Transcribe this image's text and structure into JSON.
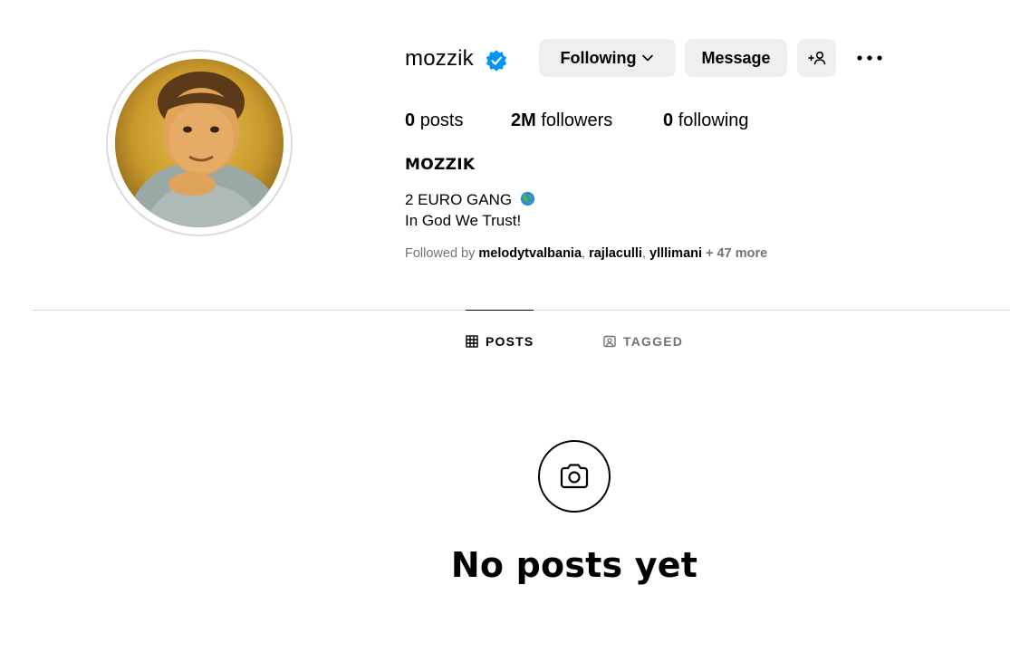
{
  "profile": {
    "username": "mozzik",
    "verified": true,
    "full_name": "MOZZIK",
    "bio_line_1": "2 EURO GANG",
    "bio_line_1_emoji": "globe-icon",
    "bio_line_2": "In God We Trust!"
  },
  "actions": {
    "following_label": "Following",
    "message_label": "Message"
  },
  "stats": {
    "posts_count": "0",
    "posts_label": "posts",
    "followers_count": "2M",
    "followers_label": "followers",
    "following_count": "0",
    "following_label": "following"
  },
  "followed_by": {
    "prefix": "Followed by",
    "names": [
      "melodytvalbania",
      "rajlaculli",
      "ylllimani"
    ],
    "more": "+ 47 more"
  },
  "tabs": [
    {
      "label": "POSTS",
      "active": true,
      "icon": "grid-icon"
    },
    {
      "label": "TAGGED",
      "active": false,
      "icon": "tagged-icon"
    }
  ],
  "empty_state": {
    "title": "No posts yet",
    "icon": "camera-icon"
  },
  "colors": {
    "verified_blue": "#0095f6",
    "button_bg": "#efefef",
    "secondary_text": "#737373",
    "divider": "#dbdbdb"
  }
}
